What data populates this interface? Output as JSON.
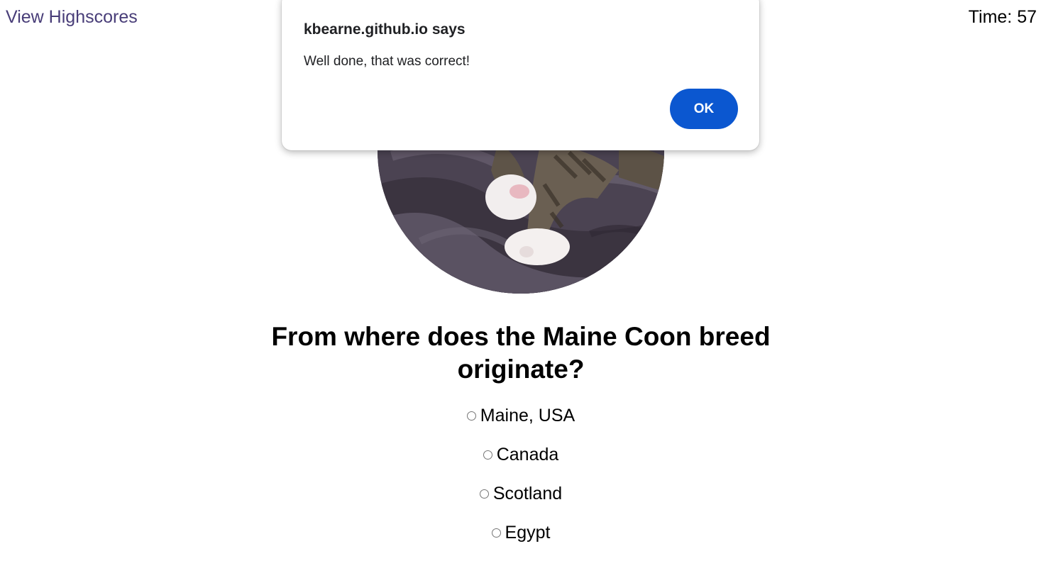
{
  "header": {
    "highscores_link": "View Highscores",
    "timer_text": "Time: 57"
  },
  "dialog": {
    "title": "kbearne.github.io says",
    "message": "Well done, that was correct!",
    "ok_label": "OK"
  },
  "quiz": {
    "question": "From where does the Maine Coon breed originate?",
    "answers": [
      {
        "label": "Maine, USA",
        "selected": false
      },
      {
        "label": "Canada",
        "selected": false
      },
      {
        "label": "Scotland",
        "selected": false
      },
      {
        "label": "Egypt",
        "selected": false
      }
    ]
  },
  "colors": {
    "link": "#483d78",
    "ok_button": "#0b57d0"
  }
}
